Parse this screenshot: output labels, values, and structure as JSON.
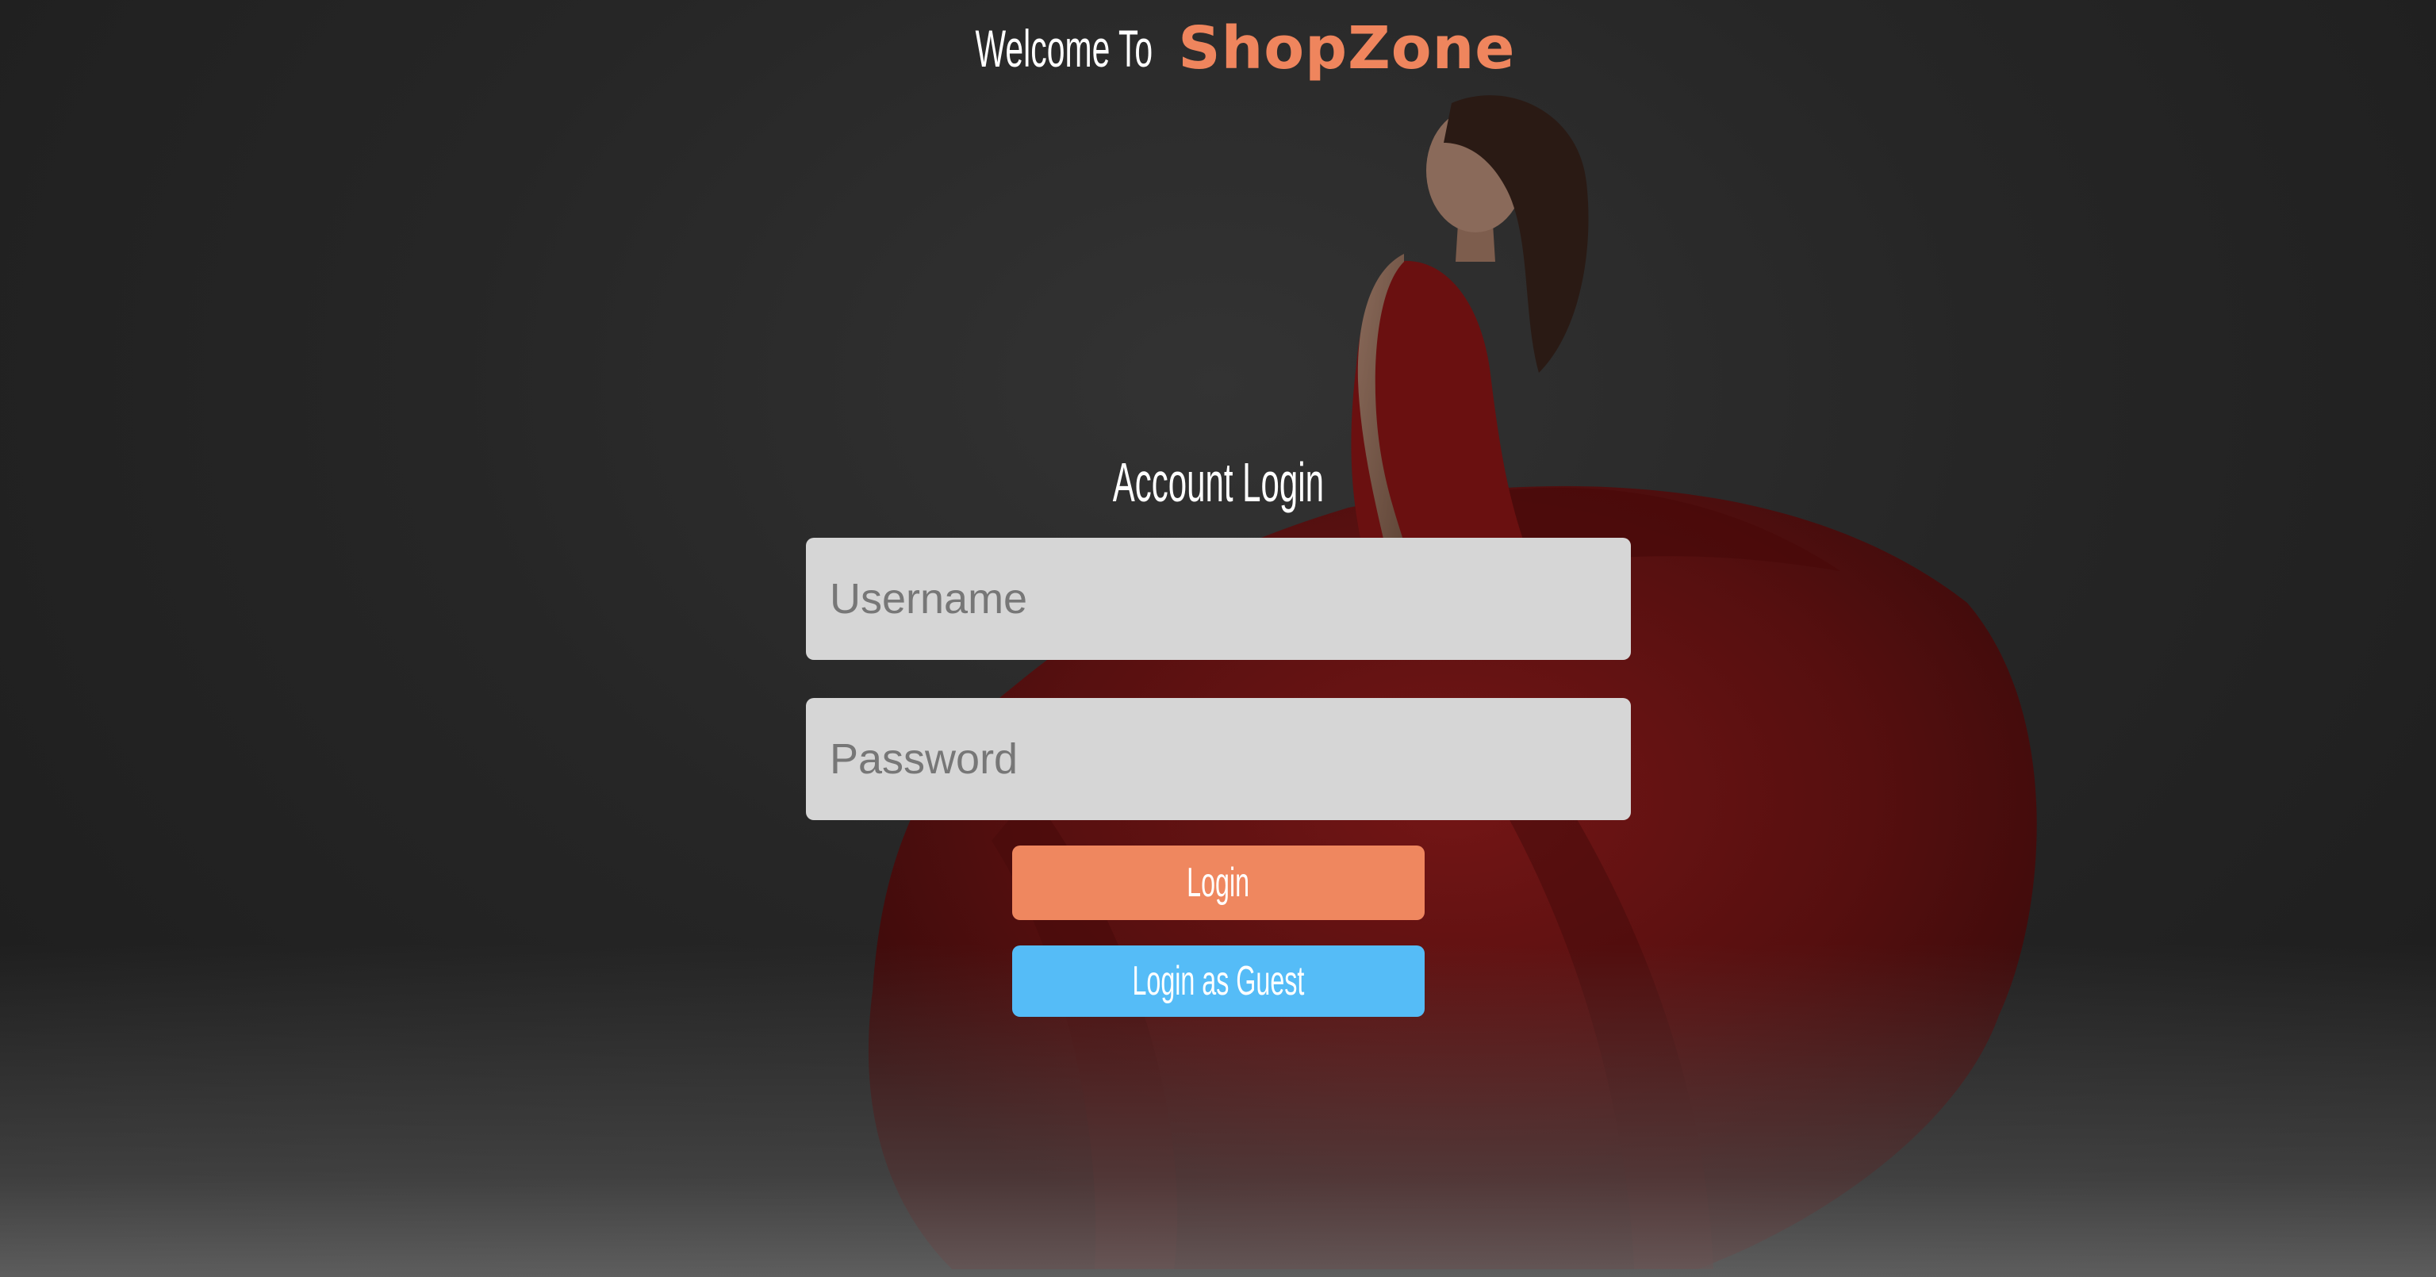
{
  "header": {
    "welcome_text": "Welcome To",
    "brand_name": "ShopZone"
  },
  "login": {
    "title": "Account Login",
    "username_placeholder": "Username",
    "password_placeholder": "Password",
    "login_label": "Login",
    "guest_label": "Login as Guest"
  },
  "colors": {
    "brand": "#ef855d",
    "login_button": "#ef875f",
    "guest_button": "#55bcf7",
    "field_background": "#d6d6d6"
  }
}
